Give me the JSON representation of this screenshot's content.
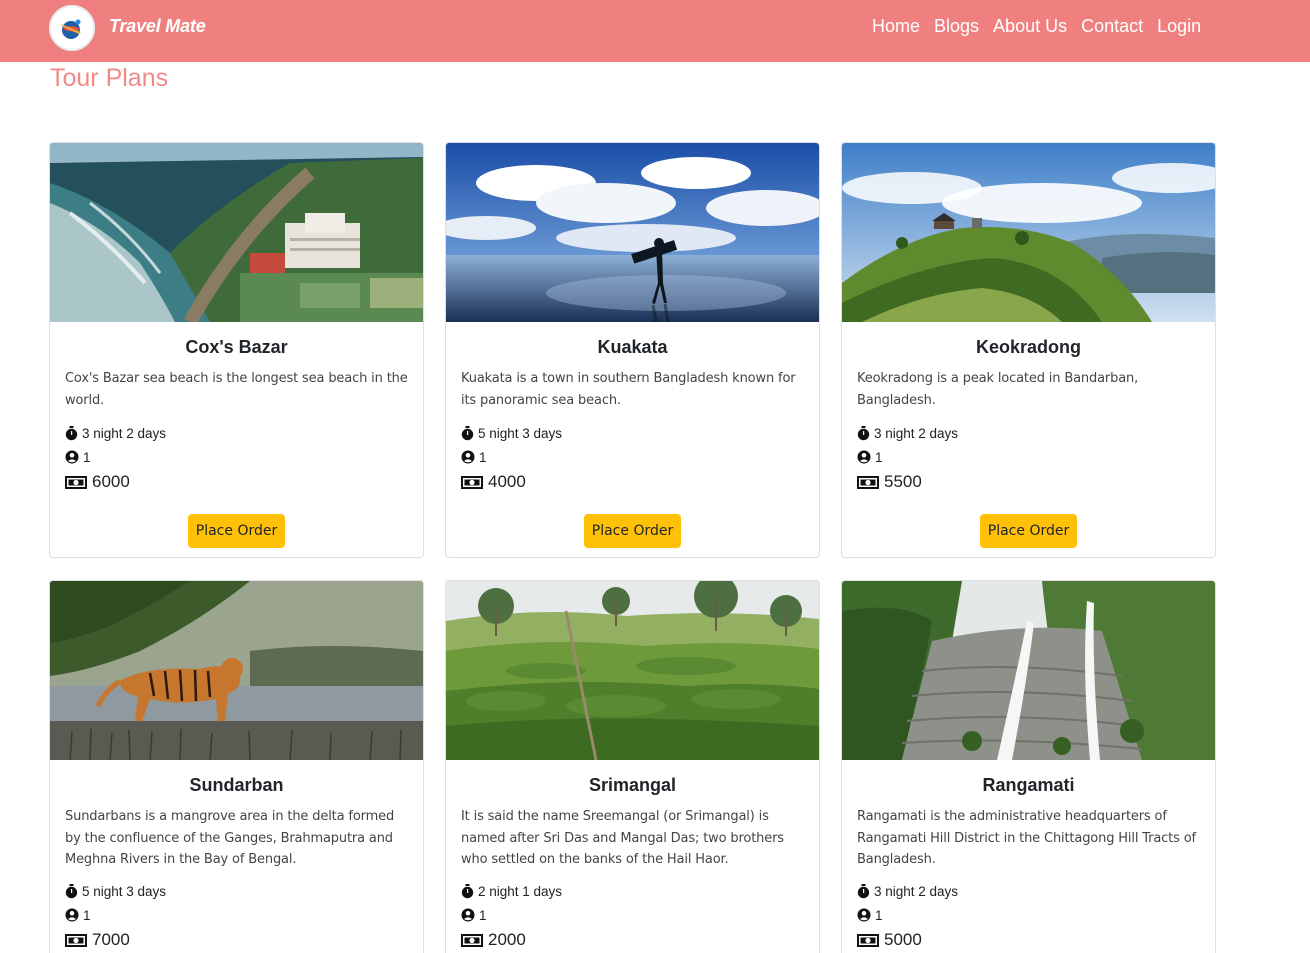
{
  "brand": {
    "name": "Travel Mate"
  },
  "nav": {
    "items": [
      "Home",
      "Blogs",
      "About Us",
      "Contact",
      "Login"
    ]
  },
  "section_title": "Tour Plans",
  "colors": {
    "navbar": "#f08080",
    "title": "#ef8a86",
    "button": "#ffc107"
  },
  "cards": [
    {
      "title": "Cox's Bazar",
      "description": "Cox's Bazar sea beach is the longest sea beach in the world.",
      "duration": "3 night 2 days",
      "persons": "1",
      "price": "6000",
      "button": "Place Order",
      "image": "beach-aerial-photo"
    },
    {
      "title": "Kuakata",
      "description": "Kuakata is a town in southern Bangladesh known for its panoramic sea beach.",
      "duration": "5 night 3 days",
      "persons": "1",
      "price": "4000",
      "button": "Place Order",
      "image": "sea-beach-silhouette-photo"
    },
    {
      "title": "Keokradong",
      "description": "Keokradong is a peak located in Bandarban, Bangladesh.",
      "duration": "3 night 2 days",
      "persons": "1",
      "price": "5500",
      "button": "Place Order",
      "image": "hill-peak-photo"
    },
    {
      "title": "Sundarban",
      "description": "Sundarbans is a mangrove area in the delta formed by the confluence of the Ganges, Brahmaputra and Meghna Rivers in the Bay of Bengal.",
      "duration": "5 night 3 days",
      "persons": "1",
      "price": "7000",
      "button": "Place Order",
      "image": "tiger-mangrove-photo"
    },
    {
      "title": "Srimangal",
      "description": "It is said the name Sreemangal (or Srimangal) is named after Sri Das and Mangal Das; two brothers who settled on the banks of the Hail Haor.",
      "duration": "2 night 1 days",
      "persons": "1",
      "price": "2000",
      "button": "Place Order",
      "image": "tea-garden-photo"
    },
    {
      "title": "Rangamati",
      "description": "Rangamati is the administrative headquarters of Rangamati Hill District in the Chittagong Hill Tracts of Bangladesh.",
      "duration": "3 night 2 days",
      "persons": "1",
      "price": "5000",
      "button": "Place Order",
      "image": "waterfall-photo"
    }
  ]
}
